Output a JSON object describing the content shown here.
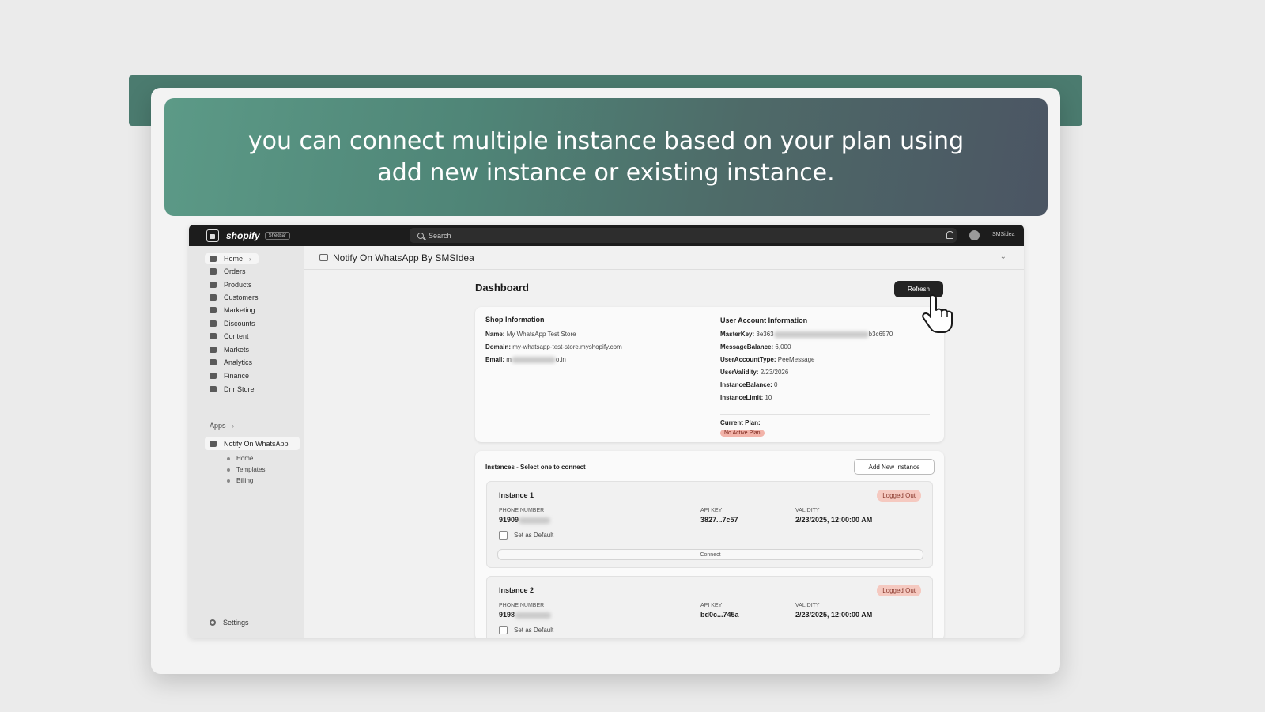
{
  "banner": {
    "text": "you can connect multiple instance based on your plan using add new instance or existing instance."
  },
  "topbar": {
    "logo_text": "shopify",
    "logo_badge": "Shedsar",
    "search_placeholder": "Search",
    "user_name": "SMSidea"
  },
  "sidebar": {
    "items": [
      {
        "label": "Home"
      },
      {
        "label": "Orders"
      },
      {
        "label": "Products"
      },
      {
        "label": "Customers"
      },
      {
        "label": "Marketing"
      },
      {
        "label": "Discounts"
      },
      {
        "label": "Content"
      },
      {
        "label": "Markets"
      },
      {
        "label": "Analytics"
      },
      {
        "label": "Finance"
      },
      {
        "label": "Dnr Store"
      }
    ],
    "apps_label": "Apps",
    "app_name": "Notify On WhatsApp",
    "app_sub_items": [
      "Home",
      "Templates",
      "Billing"
    ],
    "settings_label": "Settings"
  },
  "app_header": {
    "title": "Notify On WhatsApp By SMSIdea"
  },
  "dashboard": {
    "title": "Dashboard",
    "refresh_label": "Refresh"
  },
  "shop_info": {
    "title": "Shop Information",
    "name_label": "Name:",
    "name_value": "My WhatsApp Test Store",
    "domain_label": "Domain:",
    "domain_value": "my-whatsapp-test-store.myshopify.com",
    "email_label": "Email:",
    "email_start": "m",
    "email_end": "o.in"
  },
  "account_info": {
    "title": "User Account Information",
    "master_key_label": "MasterKey:",
    "master_key_start": "3e363",
    "master_key_end": "b3c6570",
    "message_balance_label": "MessageBalance:",
    "message_balance": "6,000",
    "account_type_label": "UserAccountType:",
    "account_type": "PeeMessage",
    "validity_label": "UserValidity:",
    "validity": "2/23/2026",
    "instance_balance_label": "InstanceBalance:",
    "instance_balance": "0",
    "instance_limit_label": "InstanceLimit:",
    "instance_limit": "10",
    "current_plan_label": "Current Plan:",
    "current_plan": "No Active Plan"
  },
  "instances": {
    "title": "Instances - Select one to connect",
    "add_button": "Add New Instance",
    "phone_label": "PHONE NUMBER",
    "api_label": "API KEY",
    "validity_label": "VALIDITY",
    "default_label": "Set as Default",
    "connect_label": "Connect",
    "list": [
      {
        "name": "Instance 1",
        "status": "Logged Out",
        "phone_start": "91909",
        "api_key": "3827...7c57",
        "validity": "2/23/2025, 12:00:00 AM"
      },
      {
        "name": "Instance 2",
        "status": "Logged Out",
        "phone_start": "9198",
        "api_key": "bd0c...745a",
        "validity": "2/23/2025, 12:00:00 AM"
      }
    ]
  },
  "colors": {
    "banner_start": "#5c9a87",
    "banner_end": "#4b5563",
    "topbar": "#1c1c1c",
    "logged_out_badge": "#f5c9c0",
    "no_plan_badge": "#f2b3a9"
  }
}
